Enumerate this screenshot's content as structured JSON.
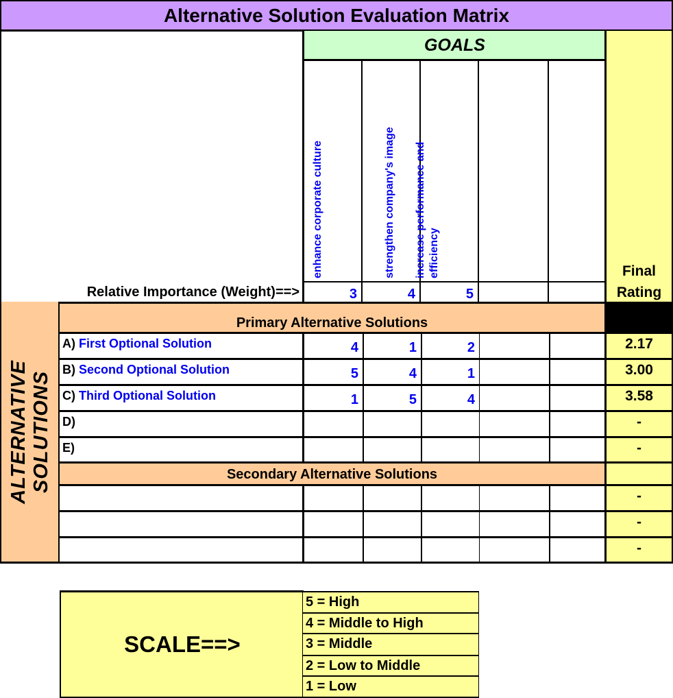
{
  "title": "Alternative Solution Evaluation Matrix",
  "goals_header": "GOALS",
  "goals": [
    {
      "label": "enhance corporate culture",
      "weight": "3"
    },
    {
      "label": "strengthen company's image",
      "weight": "4"
    },
    {
      "label": "increase performance and efficiency",
      "weight": "5"
    },
    {
      "label": "",
      "weight": ""
    },
    {
      "label": "",
      "weight": ""
    }
  ],
  "weight_label": "Relative Importance (Weight)==>",
  "final_rating_label": "Final Rating",
  "side_label_line1": "ALTERNATIVE",
  "side_label_line2": "SOLUTIONS",
  "primary_header": "Primary Alternative Solutions",
  "secondary_header": "Secondary Alternative Solutions",
  "primary_rows": [
    {
      "letter": "A)",
      "name": "First Optional Solution",
      "scores": [
        "4",
        "1",
        "2",
        "",
        ""
      ],
      "rating": "2.17"
    },
    {
      "letter": "B)",
      "name": "Second Optional Solution",
      "scores": [
        "5",
        "4",
        "1",
        "",
        ""
      ],
      "rating": "3.00"
    },
    {
      "letter": "C)",
      "name": "Third Optional Solution",
      "scores": [
        "1",
        "5",
        "4",
        "",
        ""
      ],
      "rating": "3.58"
    },
    {
      "letter": "D)",
      "name": "",
      "scores": [
        "",
        "",
        "",
        "",
        ""
      ],
      "rating": "-"
    },
    {
      "letter": "E)",
      "name": "",
      "scores": [
        "",
        "",
        "",
        "",
        ""
      ],
      "rating": "-"
    }
  ],
  "secondary_rows": [
    {
      "letter": "",
      "name": "",
      "scores": [
        "",
        "",
        "",
        "",
        ""
      ],
      "rating": "-"
    },
    {
      "letter": "",
      "name": "",
      "scores": [
        "",
        "",
        "",
        "",
        ""
      ],
      "rating": "-"
    },
    {
      "letter": "",
      "name": "",
      "scores": [
        "",
        "",
        "",
        "",
        ""
      ],
      "rating": "-"
    }
  ],
  "scale": {
    "label": "SCALE==>",
    "items": [
      "5 = High",
      "4 = Middle to High",
      "3 = Middle",
      "2 = Low to Middle",
      "1 = Low"
    ]
  },
  "colors": {
    "title_bg": "#cc99ff",
    "goals_bg": "#ccffcc",
    "rating_bg": "#ffff99",
    "section_bg": "#ffcc99",
    "value_text": "#0000ee"
  }
}
